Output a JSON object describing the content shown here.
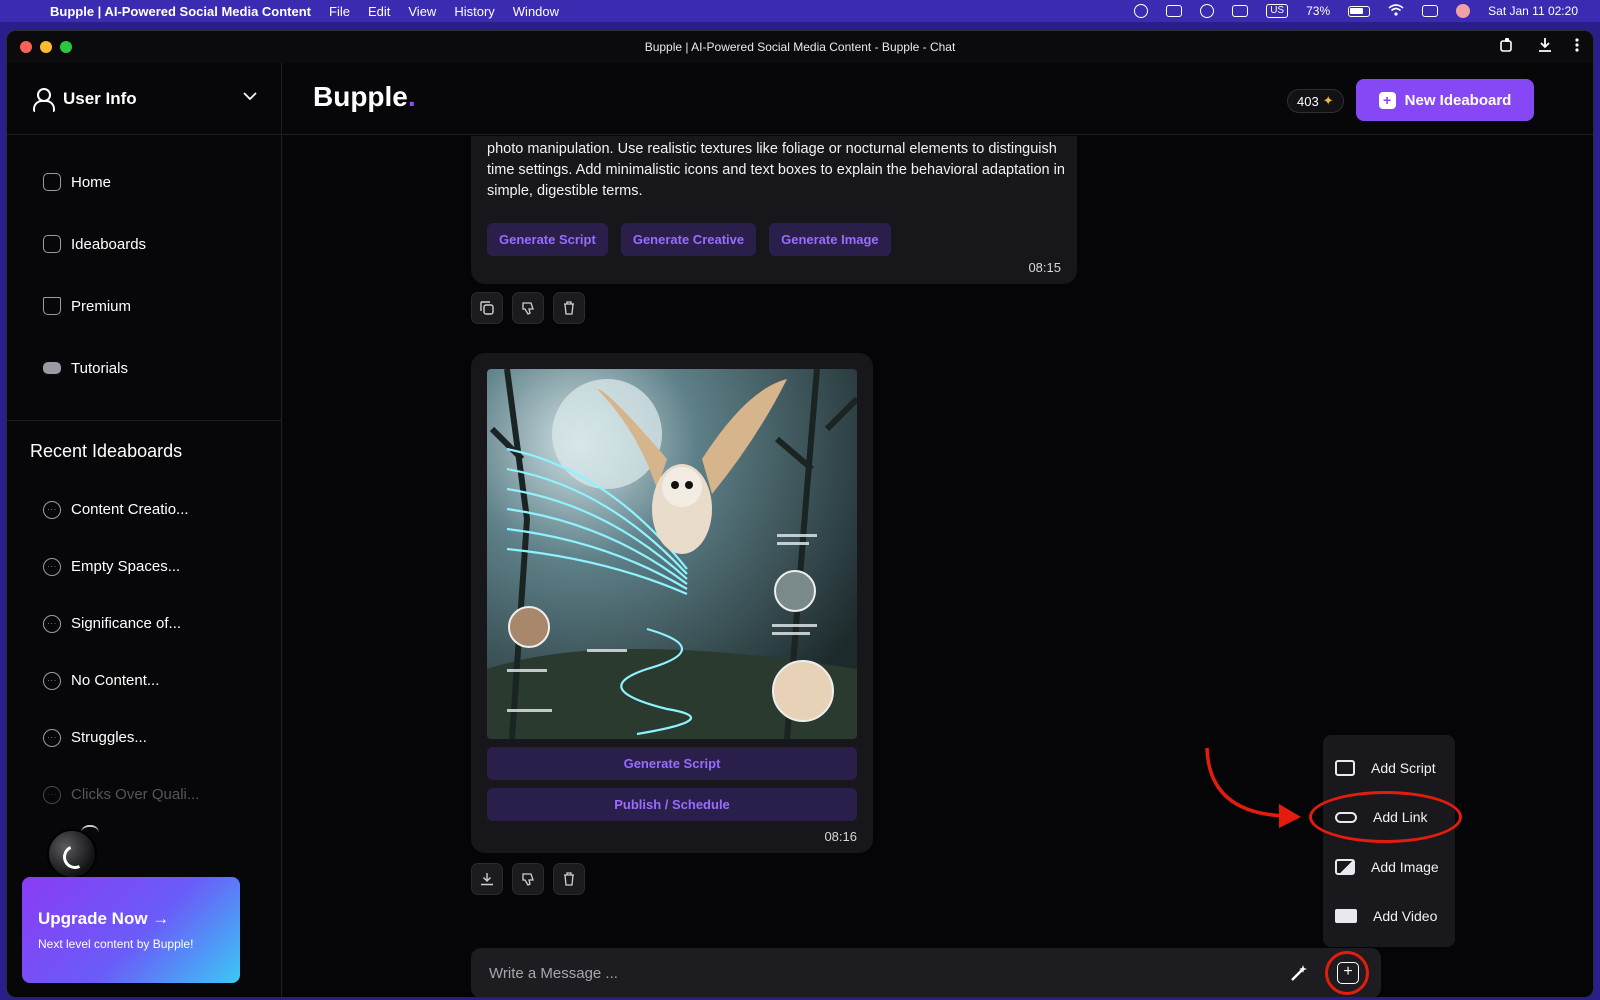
{
  "menubar": {
    "app_name": "Bupple | AI-Powered Social Media Content",
    "items": [
      "File",
      "Edit",
      "View",
      "History",
      "Window"
    ],
    "battery": "73%",
    "keyboard": "US",
    "datetime": "Sat Jan 11  02:20"
  },
  "window": {
    "title": "Bupple | AI-Powered Social Media Content - Bupple - Chat"
  },
  "sidebar": {
    "user_label": "User Info",
    "nav": [
      {
        "label": "Home",
        "icon": "home-icon"
      },
      {
        "label": "Ideaboards",
        "icon": "clipboard-icon"
      },
      {
        "label": "Premium",
        "icon": "crown-icon"
      },
      {
        "label": "Tutorials",
        "icon": "graduation-cap-icon"
      }
    ],
    "recent_title": "Recent Ideaboards",
    "recent": [
      "Content Creatio...",
      "Empty Spaces...",
      "Significance of...",
      "No Content...",
      "Struggles...",
      "Clicks Over Quali..."
    ],
    "upgrade": {
      "title": "Upgrade Now",
      "arrow": "→",
      "subtitle": "Next level content by Bupple!"
    }
  },
  "header": {
    "logo": "Bupple",
    "logo_dot": ".",
    "credits": "403",
    "new_ideaboard": "New Ideaboard"
  },
  "chat": {
    "message_text": "photo manipulation. Use realistic textures like foliage or nocturnal elements to distinguish time settings. Add minimalistic icons and text boxes to explain the behavioral adaptation in simple, digestible terms.",
    "message_actions": [
      "Generate Script",
      "Generate Creative",
      "Generate Image"
    ],
    "message_time": "08:15",
    "image_actions": [
      "Generate Script",
      "Publish / Schedule"
    ],
    "image_time": "08:16",
    "composer_placeholder": "Write a Message ..."
  },
  "attach_menu": {
    "items": [
      {
        "label": "Add Script",
        "icon": "script-icon"
      },
      {
        "label": "Add Link",
        "icon": "link-icon"
      },
      {
        "label": "Add Image",
        "icon": "image-icon"
      },
      {
        "label": "Add Video",
        "icon": "video-icon"
      }
    ]
  },
  "colors": {
    "accent": "#8647f5",
    "chip_bg": "#2a1f4a",
    "annotation_red": "#e21d0e"
  }
}
